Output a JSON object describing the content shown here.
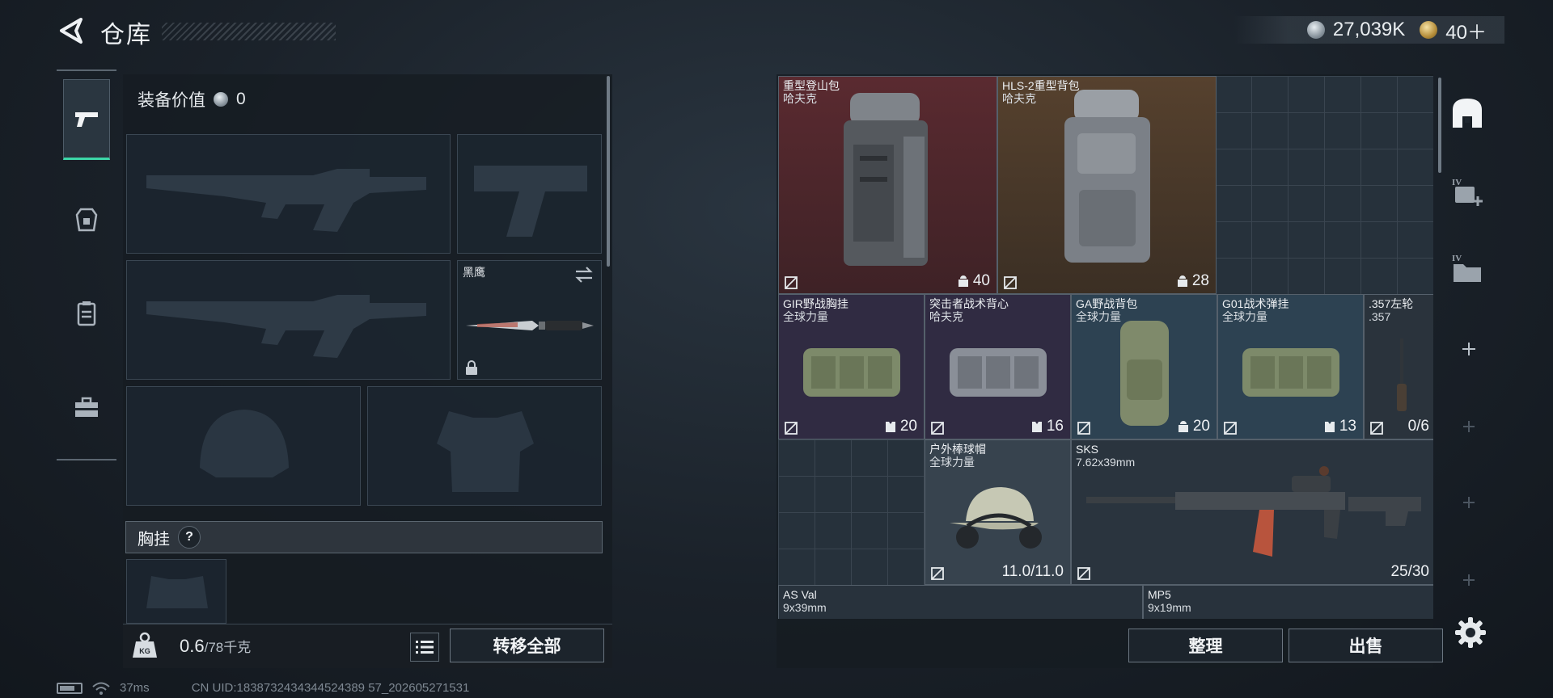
{
  "header": {
    "title": "仓库",
    "back_icon": "back-arrow-icon"
  },
  "currency": {
    "silver_amount": "27,039K",
    "gold_amount": "40＋"
  },
  "left_tabs": [
    {
      "icon": "pistol-icon",
      "active": true
    },
    {
      "icon": "armor-icon",
      "active": false
    },
    {
      "icon": "rig-icon",
      "active": false
    },
    {
      "icon": "toolbox-icon",
      "active": false
    }
  ],
  "equipment": {
    "value_label": "装备价值",
    "value": "0",
    "melee_label": "黑鹰",
    "chest_rig_label": "胸挂",
    "help_glyph": "?"
  },
  "weight": {
    "current": "0.6",
    "max": "/78千克"
  },
  "buttons": {
    "transfer_all": "转移全部",
    "sort": "整理",
    "sell": "出售"
  },
  "inventory": {
    "items": [
      {
        "name": "重型登山包",
        "sub": "哈夫克",
        "count": "40",
        "count_icon": "bag-icon"
      },
      {
        "name": "HLS-2重型背包",
        "sub": "哈夫克",
        "count": "28",
        "count_icon": "bag-icon"
      },
      {
        "name": "GIR野战胸挂",
        "sub": "全球力量",
        "count": "20",
        "count_icon": "vest-icon"
      },
      {
        "name": "突击者战术背心",
        "sub": "哈夫克",
        "count": "16",
        "count_icon": "vest-icon"
      },
      {
        "name": "GA野战背包",
        "sub": "全球力量",
        "count": "20",
        "count_icon": "bag-icon"
      },
      {
        "name": "G01战术弹挂",
        "sub": "全球力量",
        "count": "13",
        "count_icon": "vest-icon"
      },
      {
        "name": ".357左轮",
        "sub": ".357",
        "count": "0/6"
      },
      {
        "name": "户外棒球帽",
        "sub": "全球力量",
        "count": "11.0/11.0"
      },
      {
        "name": "SKS",
        "sub": "7.62x39mm",
        "count": "25/30"
      },
      {
        "name": "AS Val",
        "sub": "9x39mm"
      },
      {
        "name": "MP5",
        "sub": "9x19mm"
      }
    ]
  },
  "status": {
    "ping": "37ms",
    "uid": "CN UID:1838732434344524389 57_202605271531"
  }
}
